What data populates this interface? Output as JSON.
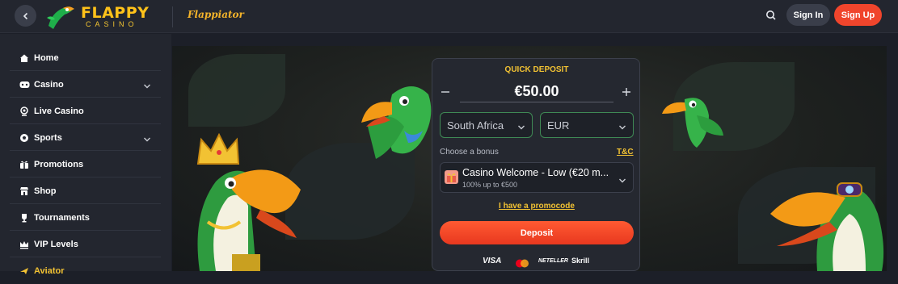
{
  "header": {
    "brand_name": "FLAPPY",
    "brand_sub": "CASINO",
    "game_logo": "Flappiator",
    "signin_label": "Sign In",
    "signup_label": "Sign Up"
  },
  "sidebar": {
    "items": [
      {
        "label": "Home",
        "icon": "home-icon",
        "has_chevron": false
      },
      {
        "label": "Casino",
        "icon": "gamepad-icon",
        "has_chevron": true
      },
      {
        "label": "Live Casino",
        "icon": "live-icon",
        "has_chevron": false
      },
      {
        "label": "Sports",
        "icon": "soccer-ball-icon",
        "has_chevron": true
      },
      {
        "label": "Promotions",
        "icon": "gift-icon",
        "has_chevron": false
      },
      {
        "label": "Shop",
        "icon": "shop-icon",
        "has_chevron": false
      },
      {
        "label": "Tournaments",
        "icon": "trophy-icon",
        "has_chevron": false
      },
      {
        "label": "VIP Levels",
        "icon": "crown-icon",
        "has_chevron": false
      },
      {
        "label": "Aviator",
        "icon": "plane-icon",
        "has_chevron": false
      }
    ]
  },
  "deposit": {
    "title": "QUICK DEPOSIT",
    "amount": "€50.00",
    "country": "South Africa",
    "currency": "EUR",
    "choose_bonus_label": "Choose a bonus",
    "tc_label": "T&C",
    "bonus_title": "Casino Welcome - Low (€20 m...",
    "bonus_sub": "100% up to €500",
    "promo_label": "I have a promocode",
    "deposit_label": "Deposit",
    "payments": [
      "VISA",
      "mastercard",
      "NETELLER",
      "Skrill"
    ]
  },
  "colors": {
    "accent": "#f2c233",
    "primary_button": "#f0452c",
    "select_border": "#3f8a55",
    "background": "#1c1f28"
  }
}
